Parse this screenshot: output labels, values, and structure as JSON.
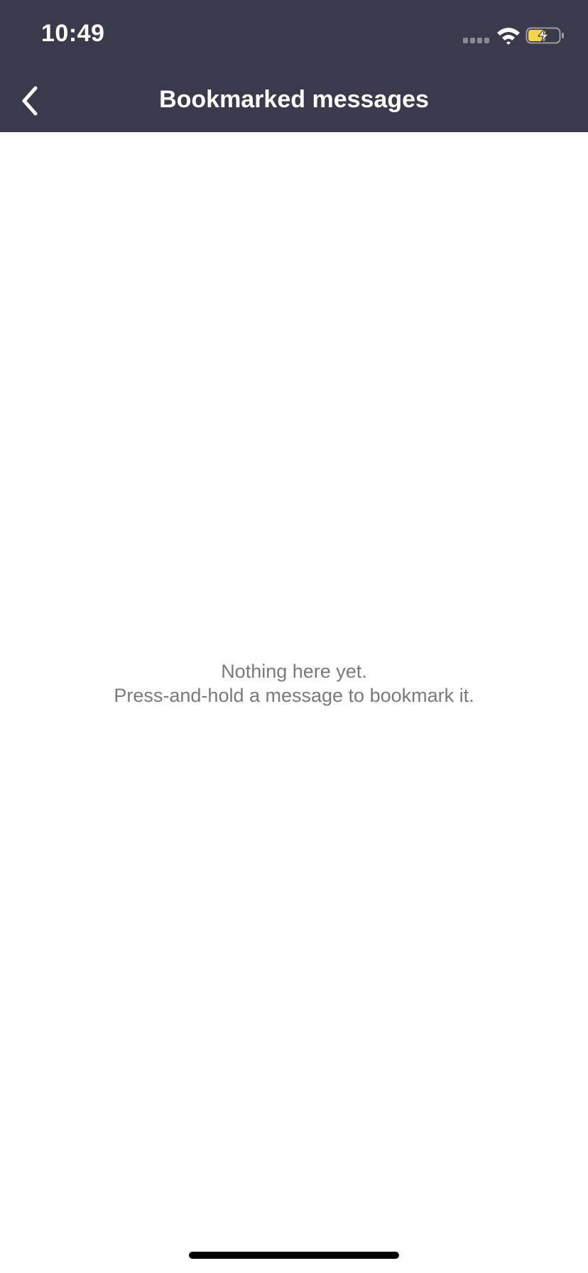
{
  "status_bar": {
    "time": "10:49",
    "signal_icon": "cellular-signal-icon",
    "wifi_icon": "wifi-icon",
    "battery_icon": "battery-charging-icon",
    "battery_color": "#f5d547"
  },
  "nav": {
    "back_icon": "chevron-left-icon",
    "title": "Bookmarked messages",
    "background_color": "#3a3a4c"
  },
  "empty_state": {
    "line1": "Nothing here yet.",
    "line2": "Press-and-hold a message to bookmark it."
  }
}
